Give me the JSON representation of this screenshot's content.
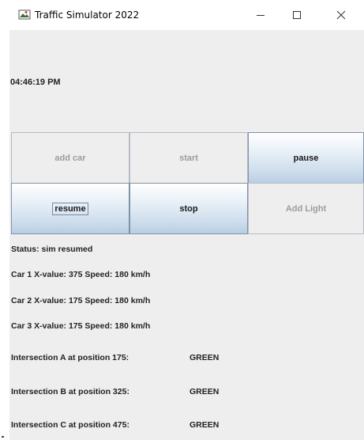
{
  "window": {
    "title": "Traffic Simulator 2022",
    "app_icon": "java-cup-icon",
    "controls": {
      "minimize_icon": "minimize-icon",
      "maximize_icon": "maximize-icon",
      "close_icon": "close-icon"
    }
  },
  "clock": "04:46:19 PM",
  "buttons": {
    "add_car": "add car",
    "start": "start",
    "pause": "pause",
    "resume": "resume",
    "stop": "stop",
    "add_light": "Add Light"
  },
  "status": "Status: sim resumed",
  "cars": [
    "Car 1 X-value: 375 Speed: 180 km/h",
    "Car 2 X-value: 175 Speed: 180 km/h",
    "Car 3 X-value: 175 Speed: 180 km/h"
  ],
  "intersections": [
    {
      "label": "Intersection A at position 175:",
      "light": "GREEN"
    },
    {
      "label": "Intersection B at position 325:",
      "light": "GREEN"
    },
    {
      "label": "Intersection C at position 475:",
      "light": "GREEN"
    }
  ],
  "colors": {
    "window_bg": "#eeeeee",
    "enabled_button_gradient_bottom": "#b9cee4",
    "disabled_text": "#9c9c9c"
  }
}
